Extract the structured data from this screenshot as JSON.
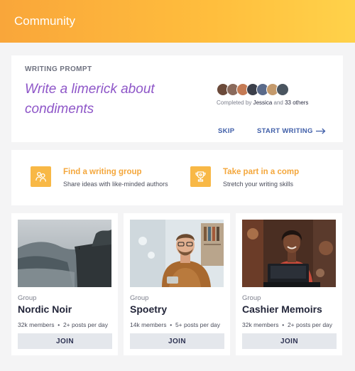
{
  "header": {
    "title": "Community"
  },
  "prompt": {
    "eyebrow": "WRITING PROMPT",
    "title": "Write a limerick about condiments",
    "completed_prefix": "Completed by ",
    "completed_name": "Jessica",
    "completed_mid": " and ",
    "completed_others": "33 others",
    "skip_label": "SKIP",
    "start_label": "START WRITING",
    "avatar_colors": [
      "#6b4a3a",
      "#8a6a5c",
      "#c47a54",
      "#3b3f4a",
      "#5a6a8a",
      "#c49a6c",
      "#4a5560"
    ]
  },
  "options": [
    {
      "title": "Find a writing group",
      "subtitle": "Share ideas with like-minded authors",
      "icon": "people-icon"
    },
    {
      "title": "Take part in a comp",
      "subtitle": "Stretch your writing skills",
      "icon": "trophy-icon"
    }
  ],
  "groups": [
    {
      "type": "Group",
      "name": "Nordic Noir",
      "members": "32k members",
      "posts": "2+ posts per day",
      "join": "JOIN"
    },
    {
      "type": "Group",
      "name": "Spoetry",
      "members": "14k members",
      "posts": "5+ posts per day",
      "join": "JOIN"
    },
    {
      "type": "Group",
      "name": "Cashier Memoirs",
      "members": "32k members",
      "posts": "2+ posts per day",
      "join": "JOIN"
    }
  ],
  "stats_separator": "•",
  "colors": {
    "accent_orange": "#f4a73c",
    "prompt_purple": "#8e56c8",
    "link_blue": "#3f5ea8"
  }
}
